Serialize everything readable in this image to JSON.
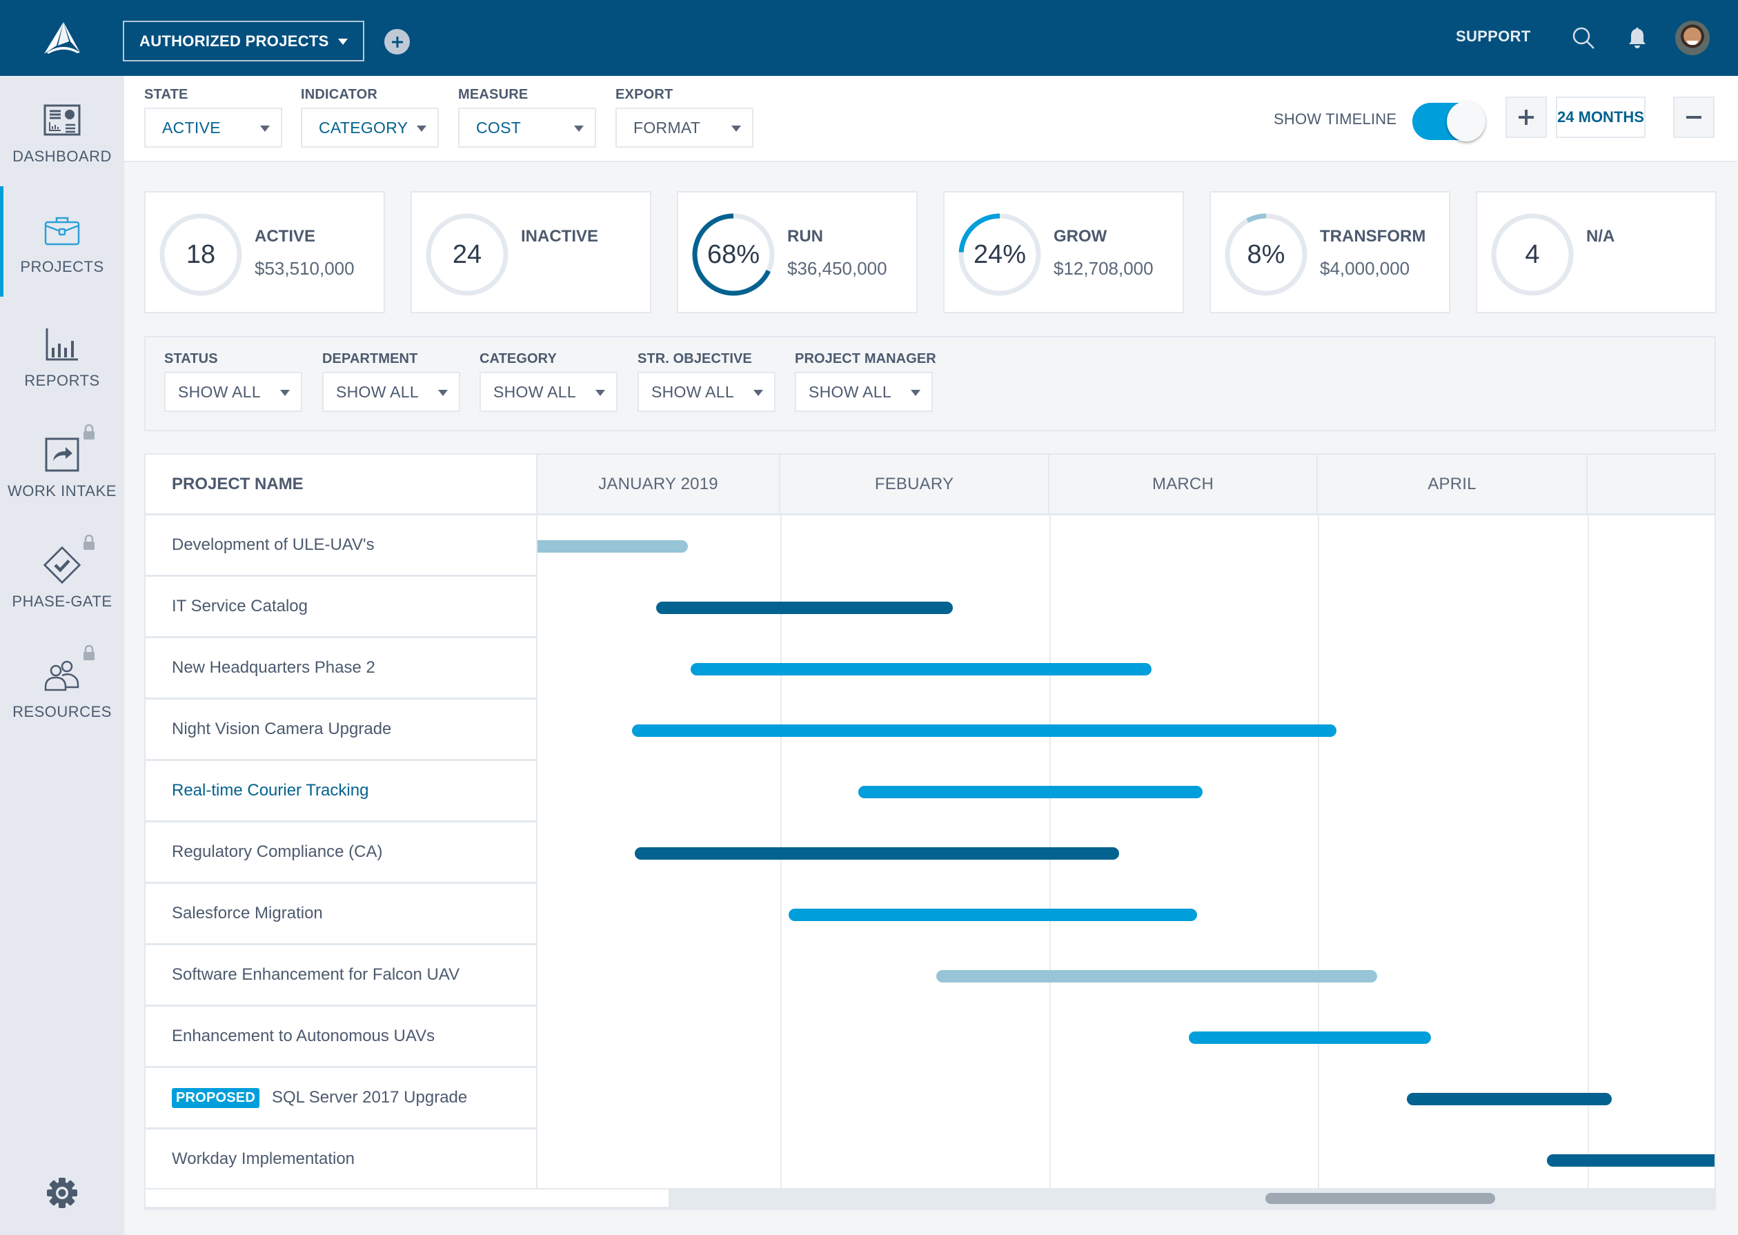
{
  "topbar": {
    "project_selector": "AUTHORIZED PROJECTS",
    "support_label": "SUPPORT",
    "icons": [
      "logo-icon",
      "add-icon",
      "search-icon",
      "bell-icon",
      "avatar"
    ]
  },
  "sidebar": {
    "items": [
      {
        "label": "DASHBOARD",
        "icon": "dashboard-icon",
        "active": false,
        "locked": false
      },
      {
        "label": "PROJECTS",
        "icon": "briefcase-icon",
        "active": true,
        "locked": false
      },
      {
        "label": "REPORTS",
        "icon": "bar-chart-icon",
        "active": false,
        "locked": false
      },
      {
        "label": "WORK INTAKE",
        "icon": "share-arrow-icon",
        "active": false,
        "locked": true
      },
      {
        "label": "PHASE-GATE",
        "icon": "diamond-check-icon",
        "active": false,
        "locked": true
      },
      {
        "label": "RESOURCES",
        "icon": "people-icon",
        "active": false,
        "locked": true
      }
    ],
    "settings_icon": "gear-icon"
  },
  "toolbar": {
    "filters": [
      {
        "label": "STATE",
        "value": "ACTIVE"
      },
      {
        "label": "INDICATOR",
        "value": "CATEGORY"
      },
      {
        "label": "MEASURE",
        "value": "COST"
      },
      {
        "label": "EXPORT",
        "value": "FORMAT"
      }
    ],
    "show_timeline_label": "SHOW TIMELINE",
    "show_timeline_on": true,
    "zoom_in_label": "+",
    "zoom_out_label": "−",
    "range_label": "24 MONTHS"
  },
  "kpis": [
    {
      "center": "18",
      "title": "ACTIVE",
      "amount": "$53,510,000",
      "fraction": 0,
      "color": "#e4e9ef"
    },
    {
      "center": "24",
      "title": "INACTIVE",
      "amount": "",
      "fraction": 0,
      "color": "#e4e9ef"
    },
    {
      "center": "68%",
      "title": "RUN",
      "amount": "$36,450,000",
      "fraction": 0.68,
      "color": "#03628f"
    },
    {
      "center": "24%",
      "title": "GROW",
      "amount": "$12,708,000",
      "fraction": 0.24,
      "color": "#009edb"
    },
    {
      "center": "8%",
      "title": "TRANSFORM",
      "amount": "$4,000,000",
      "fraction": 0.08,
      "color": "#97c4d6"
    },
    {
      "center": "4",
      "title": "N/A",
      "amount": "",
      "fraction": 0,
      "color": "#e4e9ef"
    }
  ],
  "filters": [
    {
      "label": "STATUS",
      "value": "SHOW ALL"
    },
    {
      "label": "DEPARTMENT",
      "value": "SHOW ALL"
    },
    {
      "label": "CATEGORY",
      "value": "SHOW ALL"
    },
    {
      "label": "STR. OBJECTIVE",
      "value": "SHOW ALL"
    },
    {
      "label": "PROJECT MANAGER",
      "value": "SHOW ALL"
    }
  ],
  "gantt": {
    "name_header": "PROJECT NAME",
    "months": [
      "JANUARY 2019",
      "FEBUARY",
      "MARCH",
      "APRIL",
      ""
    ],
    "colors": {
      "run": "#03628f",
      "grow": "#009edb",
      "transform": "#97c4d6"
    },
    "rows": [
      {
        "name": "Development of ULE-UAV's",
        "badge": "",
        "link": false,
        "start": 0.0,
        "end": 0.62,
        "category": "transform"
      },
      {
        "name": "IT Service Catalog",
        "badge": "",
        "link": false,
        "start": 0.49,
        "end": 1.64,
        "category": "run"
      },
      {
        "name": "New Headquarters Phase 2",
        "badge": "",
        "link": false,
        "start": 0.63,
        "end": 2.38,
        "category": "grow"
      },
      {
        "name": "Night Vision Camera Upgrade",
        "badge": "",
        "link": false,
        "start": 0.39,
        "end": 3.07,
        "category": "grow"
      },
      {
        "name": "Real-time Courier Tracking",
        "badge": "",
        "link": true,
        "start": 1.29,
        "end": 2.57,
        "category": "grow"
      },
      {
        "name": "Regulatory Compliance (CA)",
        "badge": "",
        "link": false,
        "start": 0.4,
        "end": 2.26,
        "category": "run"
      },
      {
        "name": "Salesforce Migration",
        "badge": "",
        "link": false,
        "start": 1.03,
        "end": 2.55,
        "category": "grow"
      },
      {
        "name": "Software Enhancement for Falcon UAV",
        "badge": "",
        "link": false,
        "start": 1.58,
        "end": 3.22,
        "category": "transform"
      },
      {
        "name": "Enhancement to Autonomous UAVs",
        "badge": "",
        "link": false,
        "start": 2.52,
        "end": 3.42,
        "category": "grow"
      },
      {
        "name": "SQL Server 2017 Upgrade",
        "badge": "PROPOSED",
        "link": false,
        "start": 3.33,
        "end": 4.09,
        "category": "run"
      },
      {
        "name": "Workday Implementation",
        "badge": "",
        "link": false,
        "start": 3.85,
        "end": 5.0,
        "category": "run"
      }
    ],
    "scroll_position": 0.66
  }
}
